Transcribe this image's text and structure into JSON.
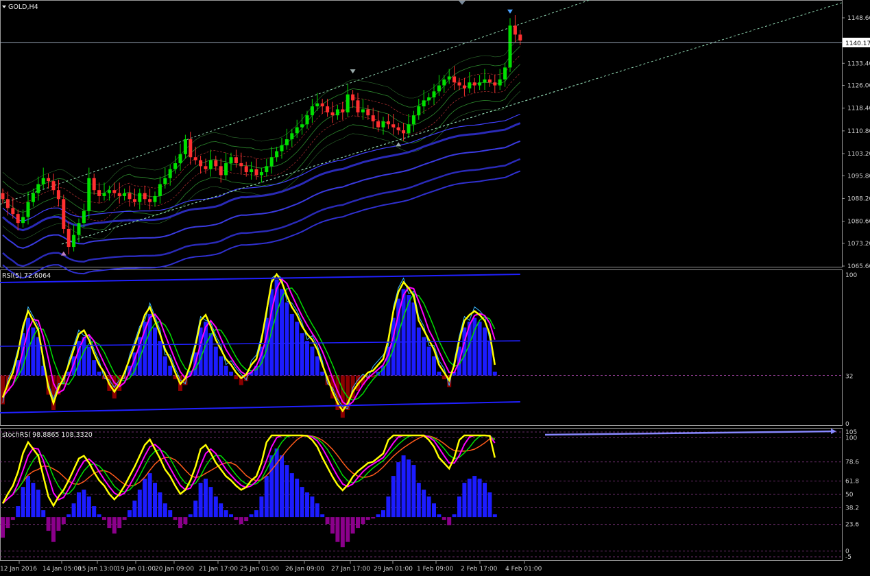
{
  "window": {
    "symbol_label": "GOLD,H4"
  },
  "rsi_title": "RSI(5) 72.6064",
  "stoch_title": "stochRSI 98.8865 108.3320",
  "price_axis": {
    "ticks": [
      "1148.60",
      "1133.40",
      "1126.00",
      "1118.40",
      "1110.80",
      "1103.20",
      "1095.80",
      "1088.20",
      "1080.60",
      "1073.20",
      "1065.60"
    ],
    "current": "1140.17"
  },
  "rsi_axis": {
    "ticks": [
      "100",
      "32",
      "0"
    ]
  },
  "stoch_axis": {
    "ticks": [
      "105",
      "100",
      "78.6",
      "61.8",
      "50",
      "38.2",
      "23.6",
      "0",
      "-5"
    ]
  },
  "time_axis": {
    "ticks": [
      "12 Jan 2016",
      "14 Jan 05:00",
      "15 Jan 13:00",
      "19 Jan 01:00",
      "20 Jan 09:00",
      "21 Jan 17:00",
      "25 Jan 01:00",
      "26 Jan 09:00",
      "27 Jan 17:00",
      "29 Jan 01:00",
      "1 Feb 09:00",
      "2 Feb 17:00",
      "4 Feb 01:00"
    ]
  },
  "colors": {
    "bull": "#00e000",
    "bear": "#ff3030",
    "rsi_pos": "#1c1cff",
    "rsi_neg": "#8b0000",
    "stoch_neg": "#8b008b",
    "grid": "#7a7a7a"
  },
  "chart_data": [
    {
      "type": "candlestick",
      "title": "GOLD,H4",
      "ylim": [
        1065.6,
        1152.0
      ],
      "current_price": 1140.17,
      "x_tick_labels": [
        "12 Jan 2016",
        "14 Jan 05:00",
        "15 Jan 13:00",
        "19 Jan 01:00",
        "20 Jan 09:00",
        "21 Jan 17:00",
        "25 Jan 01:00",
        "26 Jan 09:00",
        "27 Jan 17:00",
        "29 Jan 01:00",
        "1 Feb 09:00",
        "2 Feb 17:00",
        "4 Feb 01:00"
      ],
      "closes": [
        1088,
        1085,
        1083,
        1080,
        1082,
        1087,
        1090,
        1093,
        1095,
        1094,
        1091,
        1088,
        1078,
        1072,
        1076,
        1080,
        1084,
        1095,
        1091,
        1089,
        1090,
        1091,
        1090,
        1089,
        1090,
        1088,
        1087,
        1090,
        1088,
        1087,
        1089,
        1093,
        1095,
        1098,
        1100,
        1103,
        1108,
        1102,
        1101,
        1099,
        1098,
        1101,
        1099,
        1096,
        1100,
        1102,
        1100,
        1099,
        1097,
        1098,
        1096,
        1097,
        1099,
        1102,
        1104,
        1106,
        1108,
        1110,
        1112,
        1113,
        1116,
        1119,
        1120,
        1119,
        1117,
        1116,
        1118,
        1117,
        1123,
        1121,
        1117,
        1118,
        1116,
        1114,
        1112,
        1114,
        1113,
        1112,
        1111,
        1110,
        1113,
        1116,
        1119,
        1121,
        1122,
        1124,
        1126,
        1128,
        1129,
        1127,
        1126,
        1125,
        1127,
        1126,
        1127,
        1128,
        1127,
        1126,
        1128,
        1132,
        1146,
        1143,
        1141
      ]
    },
    {
      "type": "bar",
      "title": "RSI(5) 72.6064",
      "ylim": [
        0,
        100
      ],
      "levels": [
        32
      ],
      "histogram": [
        -15,
        -8,
        -2,
        8,
        22,
        30,
        25,
        20,
        5,
        -10,
        -18,
        -10,
        -5,
        2,
        10,
        18,
        20,
        15,
        8,
        2,
        -2,
        -8,
        -12,
        -8,
        -2,
        5,
        12,
        20,
        28,
        32,
        25,
        18,
        10,
        5,
        -2,
        -8,
        -5,
        2,
        12,
        25,
        28,
        22,
        15,
        10,
        5,
        2,
        -2,
        -5,
        -3,
        2,
        5,
        15,
        30,
        45,
        50,
        45,
        38,
        32,
        28,
        22,
        18,
        15,
        10,
        2,
        -5,
        -12,
        -18,
        -22,
        -18,
        -12,
        -8,
        -5,
        -2,
        -1,
        2,
        5,
        15,
        30,
        40,
        45,
        42,
        38,
        25,
        20,
        15,
        10,
        2,
        -2,
        -6,
        2,
        15,
        25,
        28,
        30,
        28,
        25,
        18,
        2
      ]
    },
    {
      "type": "bar",
      "title": "stochRSI 98.8865 108.3320",
      "ylim": [
        -5,
        105
      ],
      "levels": [
        105,
        100,
        78.6,
        61.8,
        50,
        38.2,
        23.6,
        0,
        -5
      ],
      "histogram": [
        -15,
        -8,
        -2,
        8,
        22,
        30,
        25,
        20,
        5,
        -10,
        -18,
        -10,
        -5,
        2,
        10,
        18,
        20,
        15,
        8,
        2,
        -2,
        -8,
        -12,
        -8,
        -2,
        5,
        12,
        20,
        28,
        32,
        25,
        18,
        10,
        5,
        -2,
        -8,
        -5,
        2,
        12,
        25,
        28,
        22,
        15,
        10,
        5,
        2,
        -2,
        -5,
        -3,
        2,
        5,
        15,
        30,
        45,
        50,
        45,
        38,
        32,
        28,
        22,
        18,
        15,
        10,
        2,
        -5,
        -12,
        -18,
        -22,
        -18,
        -12,
        -8,
        -5,
        -2,
        -1,
        2,
        5,
        15,
        30,
        40,
        45,
        42,
        38,
        25,
        20,
        15,
        10,
        2,
        -2,
        -6,
        2,
        15,
        25,
        28,
        30,
        28,
        25,
        18,
        2
      ]
    }
  ]
}
